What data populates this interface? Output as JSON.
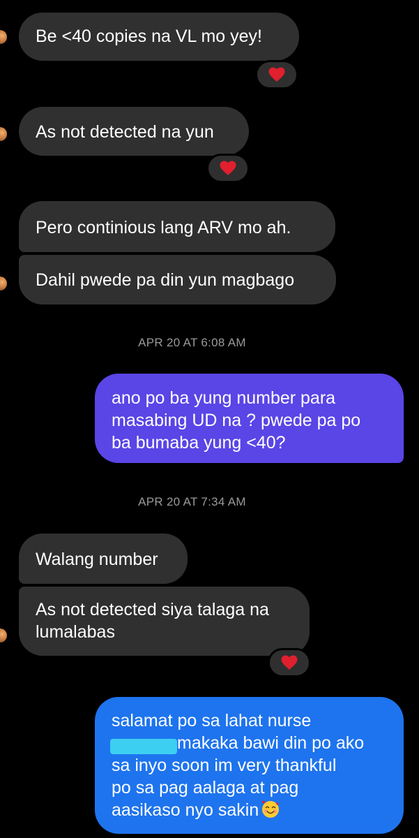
{
  "conversation": {
    "messages": [
      {
        "id": "m1",
        "from": "them",
        "lines": [
          "Be <40 copies na VL mo yey!"
        ],
        "reaction": "heart"
      },
      {
        "id": "m2",
        "from": "them",
        "lines": [
          "As not detected na yun"
        ],
        "reaction": "heart"
      },
      {
        "id": "m3",
        "from": "them",
        "lines": [
          "Pero continious lang ARV mo ah."
        ]
      },
      {
        "id": "m4",
        "from": "them",
        "lines": [
          "Dahil pwede pa din yun magbago"
        ]
      },
      {
        "id": "ts1",
        "type": "timestamp",
        "text": "APR 20 AT 6:08 AM"
      },
      {
        "id": "m5",
        "from": "me",
        "lines": [
          "ano po ba yung number para",
          "masabing UD na ? pwede pa po",
          "ba bumaba yung <40?"
        ]
      },
      {
        "id": "ts2",
        "type": "timestamp",
        "text": "APR 20 AT 7:34 AM"
      },
      {
        "id": "m6",
        "from": "them",
        "lines": [
          "Walang number"
        ]
      },
      {
        "id": "m7",
        "from": "them",
        "lines": [
          "As not detected siya talaga na",
          "lumalabas"
        ],
        "reaction": "heart"
      },
      {
        "id": "m8",
        "from": "me",
        "lines": [
          "salamat po sa lahat nurse",
          "makaka bawi din po ako",
          "sa inyo soon im very thankful",
          "po sa pag aalaga at pag",
          "aasikaso nyo sakin"
        ],
        "trailing_emoji": "smiling-face-with-hearts"
      }
    ]
  },
  "icons": {
    "reaction": "heart-icon",
    "avatar": "contact-avatar"
  },
  "colors": {
    "background": "#000000",
    "received_bubble": "#303030",
    "sent_bubble_gradient_top": "#5a45e6",
    "sent_bubble_gradient_bottom": "#1e74ee",
    "heart": "#e0202e",
    "timestamp": "#9a9a9a"
  }
}
